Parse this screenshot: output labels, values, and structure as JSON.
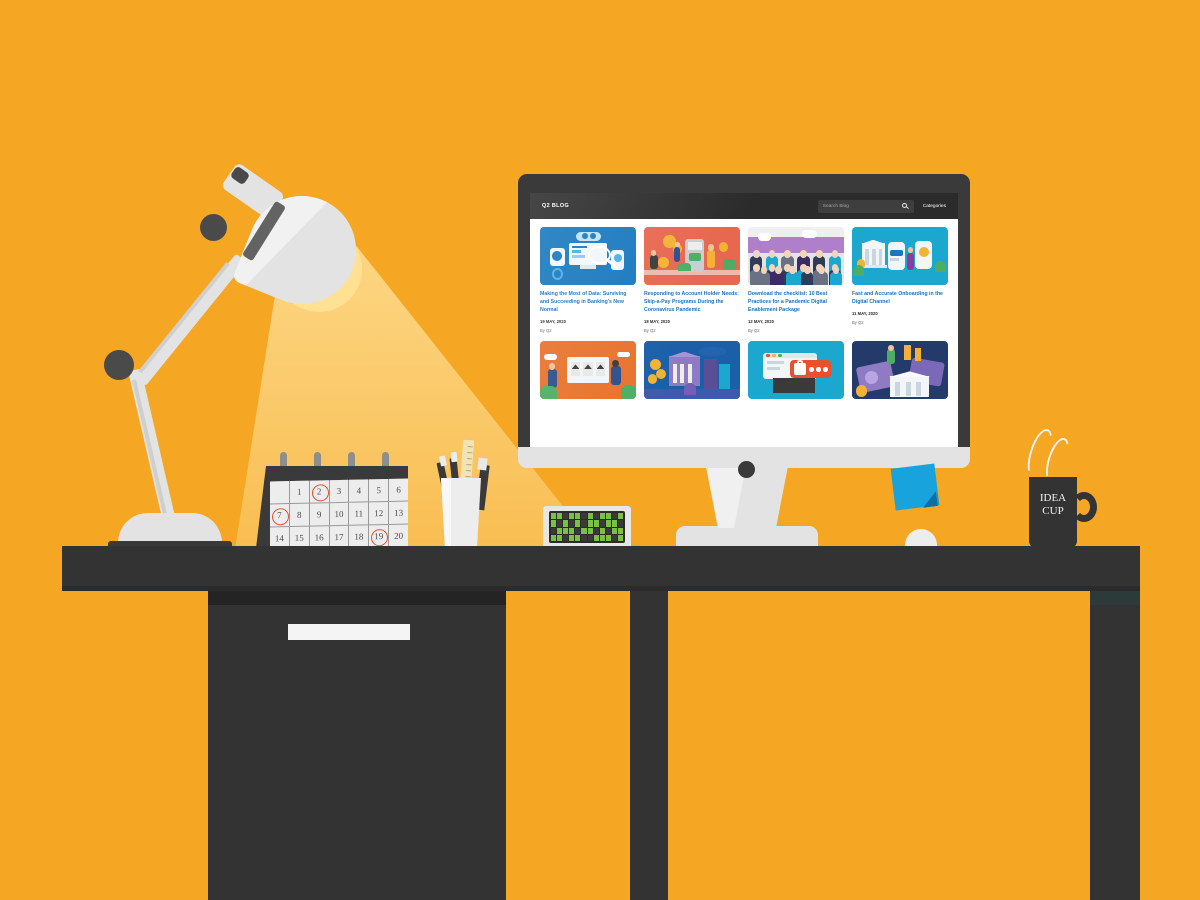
{
  "scene": {
    "name": "Flat illustration of a desk workspace with an iMac showing a blog",
    "background_color": "#F5A623",
    "desk_color": "#333333",
    "lamp_color": "#E3E3E3"
  },
  "browser": {
    "site_title": "Q2 BLOG",
    "search": {
      "placeholder": "Search Blog",
      "value": "",
      "icon": "search-icon"
    },
    "nav": {
      "categories_label": "Categories"
    },
    "header_bg": "#2B2B2B",
    "link_color": "#1D6FB8"
  },
  "articles": [
    {
      "title": "Making the Most of Data: Surviving and Succeeding in Banking's New Normal",
      "date": "19 MAY, 2020",
      "author": "By Q2",
      "thumb_color": "#1878BE",
      "thumb_art": "devices-cloud-magnifier-illustration"
    },
    {
      "title": "Responding to Account Holder Needs: Skip-a-Pay Programs During the Coronavirus Pandemic",
      "date": "18 MAY, 2020",
      "author": "By Q2",
      "thumb_color": "#E7674F",
      "thumb_art": "people-coins-atm-illustration"
    },
    {
      "title": "Download the checklist: 10 Best Practices for a Pandemic Digital Enablement Package",
      "date": "12 MAY, 2020",
      "author": "By Q2",
      "thumb_color": "#E4E4E4",
      "thumb_art": "crowd-of-people-purple-skyline-illustration"
    },
    {
      "title": "Fast and Accurate Onboarding in the Digital Channel",
      "date": "11 MAY, 2020",
      "author": "By Q2",
      "thumb_color": "#1BA7CE",
      "thumb_art": "bank-building-phones-illustration"
    }
  ],
  "articles_row2": [
    {
      "thumb_color": "#E8722C",
      "thumb_art": "people-whiteboard-orange-illustration"
    },
    {
      "thumb_color": "#1A5FA8",
      "thumb_art": "bank-coins-city-illustration"
    },
    {
      "thumb_color": "#1BA7CE",
      "thumb_art": "browser-password-lock-illustration"
    },
    {
      "thumb_color": "#243A6B",
      "thumb_art": "money-bank-navy-illustration"
    }
  ],
  "calendar": {
    "name": "desk-calendar",
    "days": [
      "",
      "1",
      "2",
      "3",
      "4",
      "5",
      "6",
      "7",
      "8",
      "9",
      "10",
      "11",
      "12",
      "13",
      "14",
      "15",
      "16",
      "17",
      "18",
      "19",
      "20"
    ],
    "circled_days": [
      "2",
      "7",
      "19"
    ],
    "circle_color": "#E8502E"
  },
  "mug": {
    "line1": "IDEA",
    "line2": "CUP",
    "color": "#333333"
  },
  "sticky_note": {
    "color": "#18A3DC",
    "text": ""
  },
  "keyboard": {
    "name": "compact-keyboard",
    "key_on_color": "#7BC043"
  },
  "desk_items": {
    "pen_cup_label": "pen-cup",
    "lamp_label": "desk-lamp",
    "mouse_label": "mouse",
    "drawer_handle_label": "drawer-handle"
  }
}
